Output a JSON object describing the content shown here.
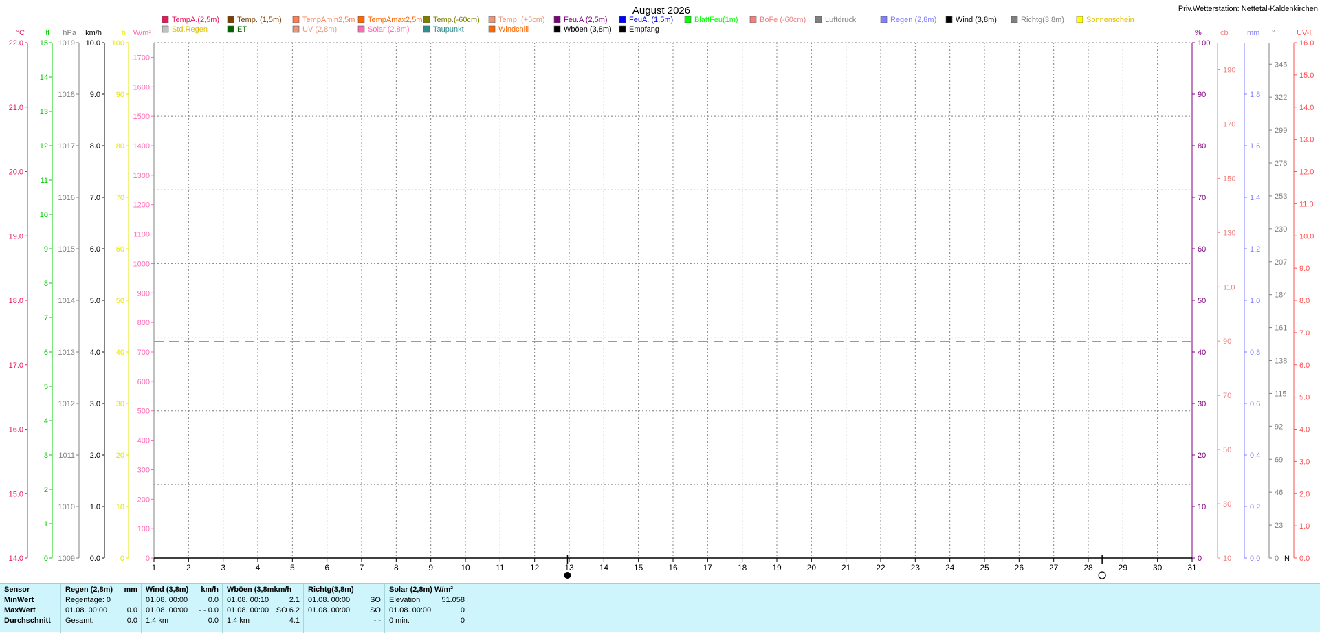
{
  "title": "August 2026",
  "station": "Priv.Wetterstation: Nettetal-Kaldenkirchen",
  "legend": [
    {
      "label": "TempA.(2,5m)",
      "color": "#e8175d"
    },
    {
      "label": "Temp. (1,5m)",
      "color": "#7b3f00"
    },
    {
      "label": "TempAmin2,5m",
      "color": "#ff7f50"
    },
    {
      "label": "TempAmax2,5m",
      "color": "#ff6600"
    },
    {
      "label": "Temp.(-60cm)",
      "color": "#808000"
    },
    {
      "label": "Temp. (+5cm)",
      "color": "#e9967a"
    },
    {
      "label": "Feu.A (2,5m)",
      "color": "#800080"
    },
    {
      "label": "FeuA. (1,5m)",
      "color": "#0000ff"
    },
    {
      "label": "BlattFeu(1m)",
      "color": "#00ff00"
    },
    {
      "label": "BoFe (-60cm)",
      "color": "#f08080"
    },
    {
      "label": "Luftdruck",
      "color": "#808080"
    },
    {
      "label": "Regen (2,8m)",
      "color": "#8080ff"
    },
    {
      "label": "Wind (3,8m)",
      "color": "#000000"
    },
    {
      "label": "Richtg(3,8m)",
      "color": "#808080"
    },
    {
      "label": "Sonnenschein",
      "color": "#ffff00"
    },
    {
      "label": "Std.Regen",
      "color": "#c0c0c0"
    },
    {
      "label": "ET",
      "color": "#006400"
    },
    {
      "label": "UV (2,8m)",
      "color": "#e9967a"
    },
    {
      "label": "Solar (2,8m)",
      "color": "#ff69b4"
    },
    {
      "label": "Taupunkt",
      "color": "#2f8f8f"
    },
    {
      "label": "Windchill",
      "color": "#ff6600"
    },
    {
      "label": "Wböen (3,8m)",
      "color": "#000000"
    },
    {
      "label": "Empfang",
      "color": "#000000"
    }
  ],
  "chart_data": {
    "type": "line",
    "title": "August 2026",
    "x": [
      1,
      2,
      3,
      4,
      5,
      6,
      7,
      8,
      9,
      10,
      11,
      12,
      13,
      14,
      15,
      16,
      17,
      18,
      19,
      20,
      21,
      22,
      23,
      24,
      25,
      26,
      27,
      28,
      29,
      30,
      31
    ],
    "xlim": [
      1,
      31
    ],
    "grid": true,
    "series": [],
    "y_axes": [
      {
        "unit": "°C",
        "color": "#e8175d",
        "range": [
          14.0,
          22.0
        ],
        "side": "left",
        "ticks": [
          "14.0",
          "15.0",
          "16.0",
          "17.0",
          "18.0",
          "19.0",
          "20.0",
          "21.0",
          "22.0"
        ]
      },
      {
        "unit": "lf",
        "color": "#00cc00",
        "range": [
          0,
          15
        ],
        "side": "left",
        "ticks": [
          "0",
          "1",
          "2",
          "3",
          "4",
          "5",
          "6",
          "7",
          "8",
          "9",
          "10",
          "11",
          "12",
          "13",
          "14",
          "15"
        ]
      },
      {
        "unit": "hPa",
        "color": "#808080",
        "range": [
          1009,
          1019
        ],
        "side": "left",
        "ticks": [
          "1009",
          "1010",
          "1011",
          "1012",
          "1013",
          "1014",
          "1015",
          "1016",
          "1017",
          "1018",
          "1019"
        ]
      },
      {
        "unit": "km/h",
        "color": "#000000",
        "range": [
          0.0,
          10.0
        ],
        "side": "left",
        "ticks": [
          "0.0",
          "1.0",
          "2.0",
          "3.0",
          "4.0",
          "5.0",
          "6.0",
          "7.0",
          "8.0",
          "9.0",
          "10.0"
        ]
      },
      {
        "unit": "h",
        "color": "#e6e600",
        "range": [
          0,
          100
        ],
        "side": "left",
        "ticks": [
          "0",
          "10",
          "20",
          "30",
          "40",
          "50",
          "60",
          "70",
          "80",
          "90",
          "100"
        ]
      },
      {
        "unit": "W/m²",
        "color": "#ff69b4",
        "range": [
          0,
          1750
        ],
        "side": "left",
        "ticks": [
          "0",
          "100",
          "200",
          "300",
          "400",
          "500",
          "600",
          "700",
          "800",
          "900",
          "1000",
          "1100",
          "1200",
          "1300",
          "1400",
          "1500",
          "1600",
          "1700"
        ]
      },
      {
        "unit": "%",
        "color": "#800080",
        "range": [
          0,
          100
        ],
        "side": "right",
        "ticks": [
          "0",
          "10",
          "20",
          "30",
          "40",
          "50",
          "60",
          "70",
          "80",
          "90",
          "100"
        ]
      },
      {
        "unit": "cb",
        "color": "#f08080",
        "range": [
          10,
          200
        ],
        "side": "right",
        "ticks": [
          "10",
          "30",
          "50",
          "70",
          "90",
          "110",
          "130",
          "150",
          "170",
          "190"
        ]
      },
      {
        "unit": "mm",
        "color": "#8080ff",
        "range": [
          0.0,
          2.0
        ],
        "side": "right",
        "ticks": [
          "0.0",
          "0.2",
          "0.4",
          "0.6",
          "0.8",
          "1.0",
          "1.2",
          "1.4",
          "1.6",
          "1.8"
        ]
      },
      {
        "unit": "°",
        "color": "#808080",
        "range": [
          0,
          360
        ],
        "side": "right",
        "ticks": [
          "0",
          "23",
          "46",
          "69",
          "92",
          "115",
          "138",
          "161",
          "184",
          "207",
          "230",
          "253",
          "276",
          "299",
          "322",
          "345"
        ],
        "extra_label": "N"
      },
      {
        "unit": "UV-I",
        "color": "#ff5050",
        "range": [
          0.0,
          16.0
        ],
        "side": "right",
        "ticks": [
          "0.0",
          "1.0",
          "2.0",
          "3.0",
          "4.0",
          "5.0",
          "6.0",
          "7.0",
          "8.0",
          "9.0",
          "10.0",
          "11.0",
          "12.0",
          "13.0",
          "14.0",
          "15.0",
          "16.0"
        ]
      }
    ],
    "reference_line_hpa": 1013.2,
    "moon_phases": [
      {
        "day": 12.95,
        "phase": "full"
      },
      {
        "day": 28.4,
        "phase": "new"
      }
    ]
  },
  "stats": {
    "sensor_col": {
      "header": "Sensor",
      "rows": [
        "MinWert",
        "MaxWert",
        "Durchschnitt"
      ]
    },
    "regen": {
      "header": "Regen (2,8m)",
      "unit": "mm",
      "r1": {
        "a": "Regentage: 0",
        "b": ""
      },
      "r2": {
        "a": "01.08.  00:00",
        "b": "0.0"
      },
      "r3": {
        "a": "Gesamt:",
        "b": "0.0"
      }
    },
    "wind": {
      "header": "Wind (3,8m)",
      "unit": "km/h",
      "r1": {
        "a": "01.08.  00:00",
        "b": "0.0"
      },
      "r2": {
        "a": "01.08.  00:00",
        "b": "- - 0.0"
      },
      "r3": {
        "a": "1.4 km",
        "b": "0.0"
      }
    },
    "wboen": {
      "header": "Wböen (3,8mkm/h",
      "r1": {
        "a": "01.08.  00:10",
        "b": "2.1"
      },
      "r2": {
        "a": "01.08.  00:00",
        "b": "SO 6.2"
      },
      "r3": {
        "a": "1.4 km",
        "b": "4.1"
      }
    },
    "richtg": {
      "header": "Richtg(3,8m)",
      "r1": {
        "a": "01.08.  00:00",
        "b": "SO"
      },
      "r2": {
        "a": "01.08.  00:00",
        "b": "SO"
      },
      "r3": {
        "a": "",
        "b": "- -"
      }
    },
    "solar": {
      "header": "Solar (2,8m) W/m²",
      "r1": {
        "a": "Elevation",
        "b": "51.058"
      },
      "r2": {
        "a": "01.08.  00:00",
        "b": "0"
      },
      "r3": {
        "a": "0 min.",
        "b": "0"
      }
    }
  }
}
